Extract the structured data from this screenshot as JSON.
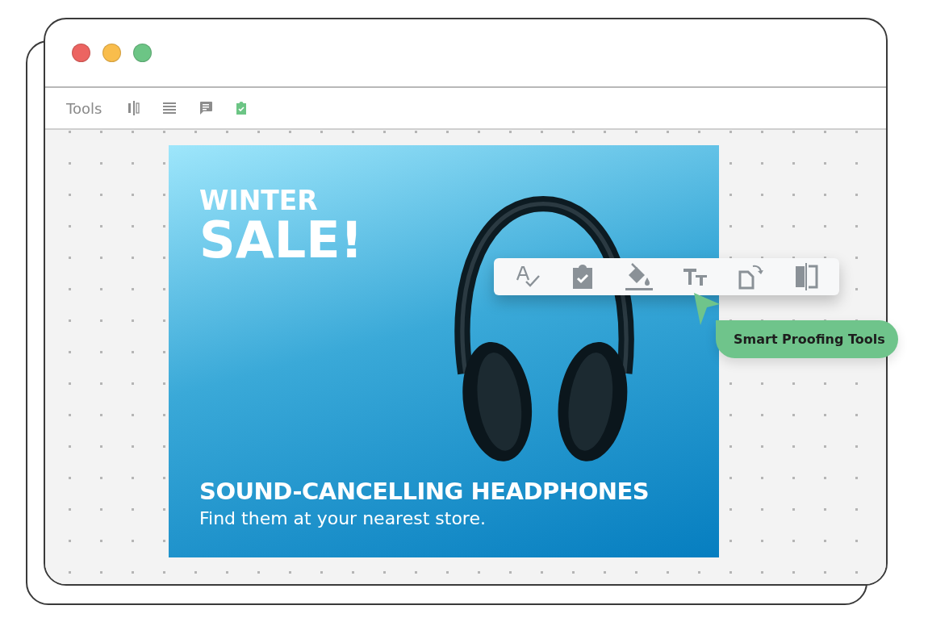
{
  "toolbar": {
    "label": "Tools",
    "tools": [
      {
        "kind": "columns",
        "selected": false
      },
      {
        "kind": "lines",
        "selected": false
      },
      {
        "kind": "comment",
        "selected": false
      },
      {
        "kind": "proof",
        "selected": true
      }
    ]
  },
  "ad": {
    "eyebrow": "WINTER",
    "headline": "SALE!",
    "product": "SOUND-CANCELLING HEADPHONES",
    "tagline": "Find them at your nearest store."
  },
  "floating_toolbar": {
    "tools": [
      {
        "kind": "spellcheck"
      },
      {
        "kind": "proof"
      },
      {
        "kind": "fill"
      },
      {
        "kind": "text-size"
      },
      {
        "kind": "rotate"
      },
      {
        "kind": "flip"
      }
    ]
  },
  "tooltip": {
    "text": "Smart Proofing Tools"
  }
}
